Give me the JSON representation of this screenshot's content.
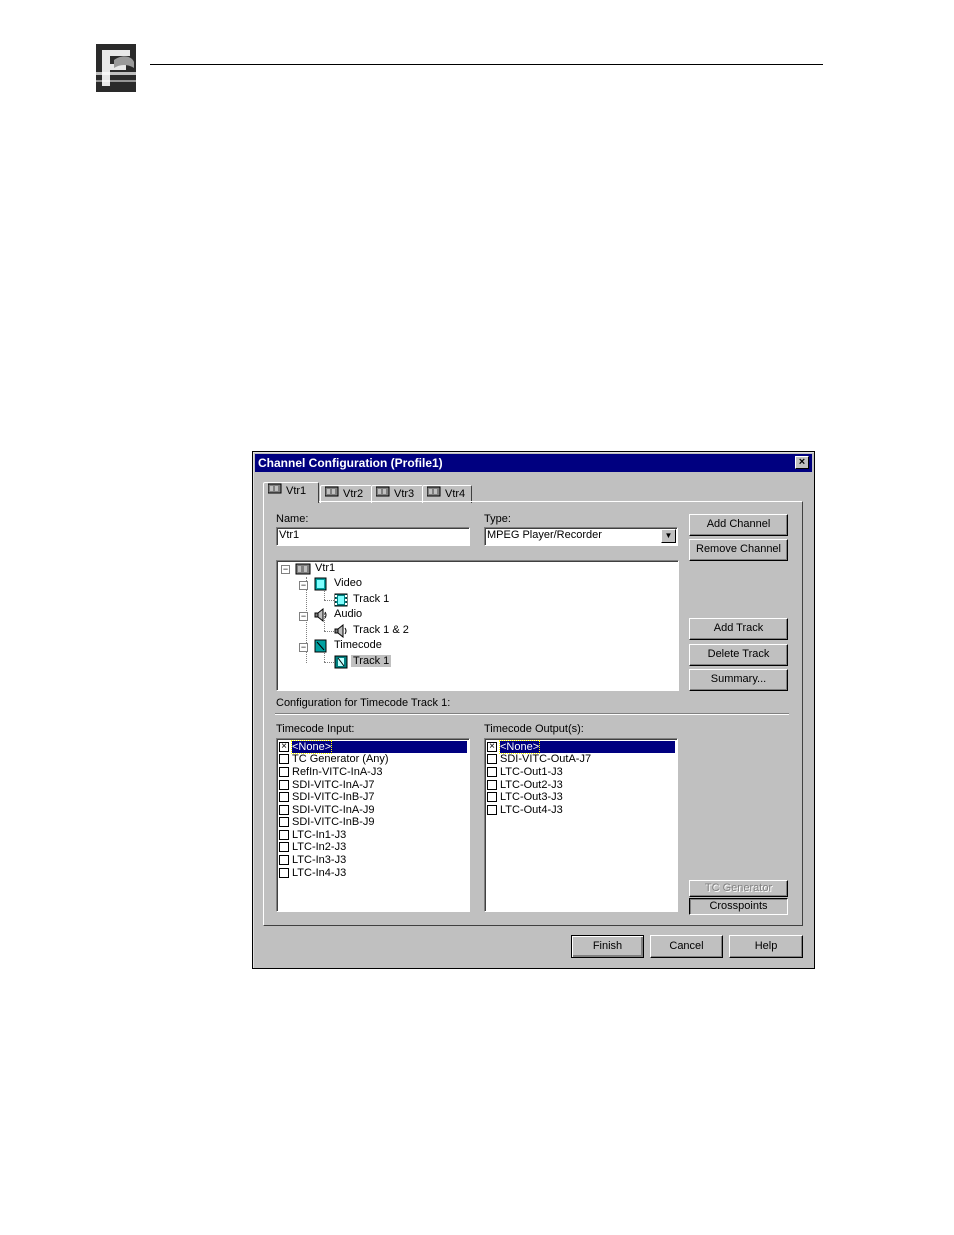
{
  "dialog": {
    "title": "Channel Configuration (Profile1)",
    "close_glyph": "×"
  },
  "tabs": [
    {
      "label": "Vtr1",
      "active": true
    },
    {
      "label": "Vtr2",
      "active": false
    },
    {
      "label": "Vtr3",
      "active": false
    },
    {
      "label": "Vtr4",
      "active": false
    }
  ],
  "fields": {
    "name_label": "Name:",
    "name_value": "Vtr1",
    "type_label": "Type:",
    "type_value": "MPEG Player/Recorder"
  },
  "buttons": {
    "add_channel": "Add Channel",
    "remove_channel": "Remove Channel",
    "add_track": "Add Track",
    "delete_track": "Delete Track",
    "summary": "Summary...",
    "tc_generator": "TC Generator",
    "crosspoints": "Crosspoints",
    "finish": "Finish",
    "cancel": "Cancel",
    "help": "Help"
  },
  "tree": {
    "root": "Vtr1",
    "video": "Video",
    "video_track": "Track 1",
    "audio": "Audio",
    "audio_track": "Track 1 & 2",
    "timecode": "Timecode",
    "timecode_track": "Track 1"
  },
  "config_heading": "Configuration for Timecode Track 1:",
  "timecode_input": {
    "label": "Timecode Input:",
    "items": [
      {
        "text": "<None>",
        "checked": true,
        "selected": true
      },
      {
        "text": "TC Generator (Any)",
        "checked": false
      },
      {
        "text": "RefIn-VITC-InA-J3",
        "checked": false
      },
      {
        "text": "SDI-VITC-InA-J7",
        "checked": false
      },
      {
        "text": "SDI-VITC-InB-J7",
        "checked": false
      },
      {
        "text": "SDI-VITC-InA-J9",
        "checked": false
      },
      {
        "text": "SDI-VITC-InB-J9",
        "checked": false
      },
      {
        "text": "LTC-In1-J3",
        "checked": false
      },
      {
        "text": "LTC-In2-J3",
        "checked": false
      },
      {
        "text": "LTC-In3-J3",
        "checked": false
      },
      {
        "text": "LTC-In4-J3",
        "checked": false
      }
    ]
  },
  "timecode_output": {
    "label": "Timecode Output(s):",
    "items": [
      {
        "text": "<None>",
        "checked": true,
        "selected": true
      },
      {
        "text": "SDI-VITC-OutA-J7",
        "checked": false
      },
      {
        "text": "LTC-Out1-J3",
        "checked": false
      },
      {
        "text": "LTC-Out2-J3",
        "checked": false
      },
      {
        "text": "LTC-Out3-J3",
        "checked": false
      },
      {
        "text": "LTC-Out4-J3",
        "checked": false
      }
    ]
  }
}
